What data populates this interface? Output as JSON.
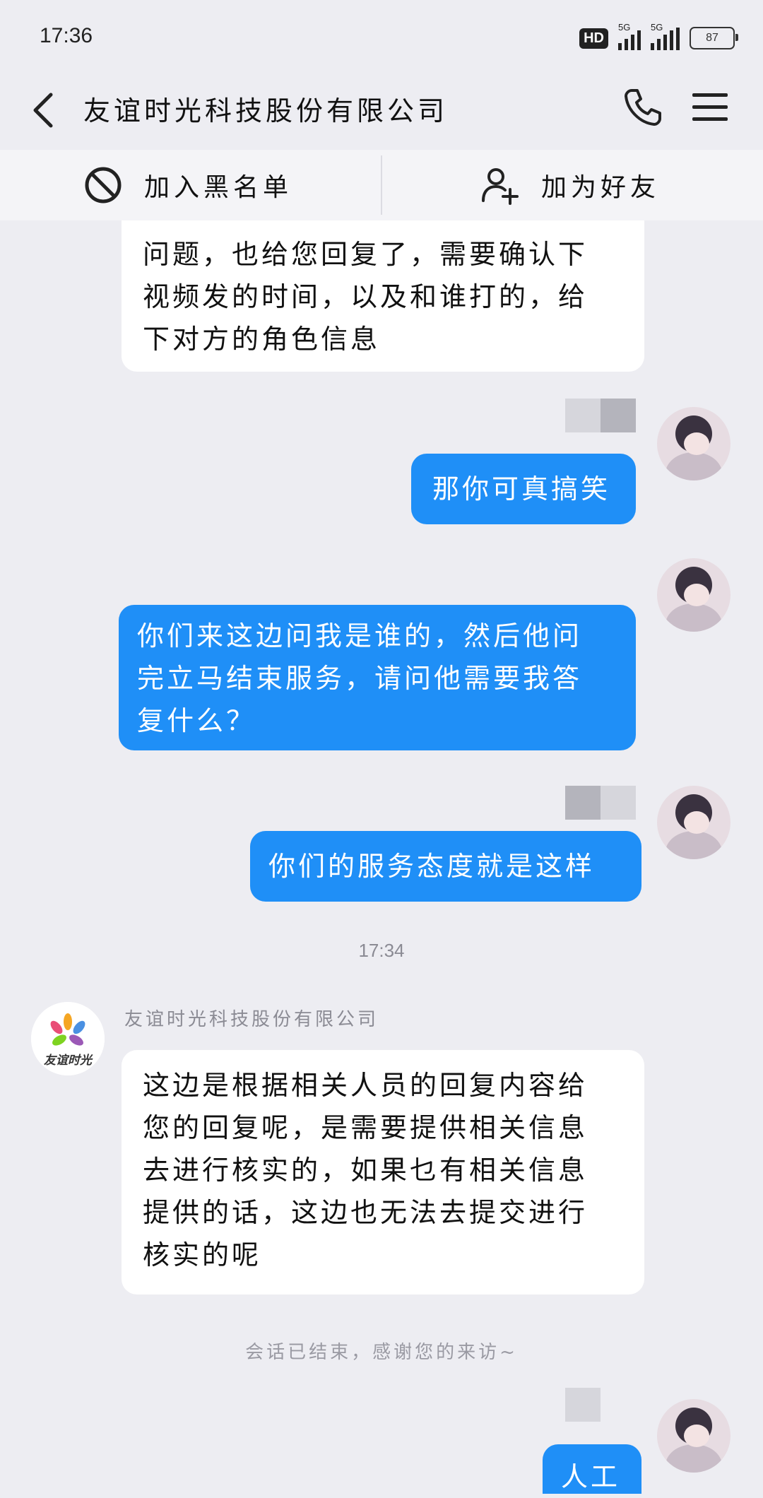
{
  "status_bar": {
    "time": "17:36",
    "hd_badge": "HD",
    "network_1": "5G",
    "network_2": "5G",
    "battery": "87"
  },
  "header": {
    "title": "友谊时光科技股份有限公司"
  },
  "action_bar": {
    "blacklist_label": "加入黑名单",
    "add_friend_label": "加为好友"
  },
  "messages": [
    {
      "side": "left",
      "lines": [
        "问题，也给您回复了，需要确认下",
        "视频发的时间，以及和谁打的，给",
        "下对方的角色信息"
      ]
    },
    {
      "side": "right",
      "lines": [
        "那你可真搞笑"
      ]
    },
    {
      "side": "right",
      "lines": [
        "你们来这边问我是谁的，然后他问",
        "完立马结束服务，请问他需要我答",
        "复什么？"
      ]
    },
    {
      "side": "right",
      "lines": [
        "你们的服务态度就是这样"
      ]
    },
    {
      "side": "left",
      "lines": [
        "这边是根据相关人员的回复内容给",
        "您的回复呢，是需要提供相关信息",
        "去进行核实的，如果乜有相关信息",
        "提供的话，这边也无法去提交进行",
        "核实的呢"
      ]
    },
    {
      "side": "right",
      "lines": [
        "人工"
      ]
    }
  ],
  "timestamp": "17:34",
  "sender_name": "友谊时光科技股份有限公司",
  "company_logo_text": "友谊时光",
  "system_message": "会话已结束，感谢您的来访~",
  "colors": {
    "background": "#ededf2",
    "bubble_blue": "#1f8ff7",
    "bubble_white": "#ffffff"
  },
  "icons": [
    "back-icon",
    "phone-icon",
    "menu-icon",
    "block-icon",
    "add-user-icon"
  ]
}
